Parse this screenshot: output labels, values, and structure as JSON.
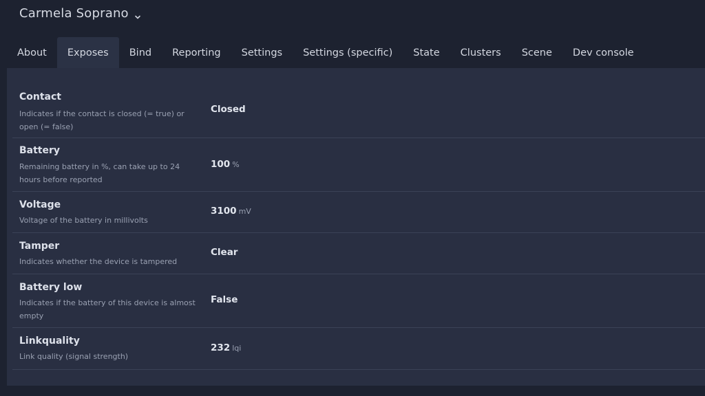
{
  "device": {
    "name": "Carmela Soprano",
    "chevron_icon": "chevron-down-icon"
  },
  "tabs": [
    {
      "label": "About"
    },
    {
      "label": "Exposes"
    },
    {
      "label": "Bind"
    },
    {
      "label": "Reporting"
    },
    {
      "label": "Settings"
    },
    {
      "label": "Settings (specific)"
    },
    {
      "label": "State"
    },
    {
      "label": "Clusters"
    },
    {
      "label": "Scene"
    },
    {
      "label": "Dev console"
    }
  ],
  "active_tab": "Exposes",
  "exposes": [
    {
      "title": "Contact",
      "description": "Indicates if the contact is closed (= true) or open (= false)",
      "value": "Closed",
      "unit": ""
    },
    {
      "title": "Battery",
      "description": "Remaining battery in %, can take up to 24 hours before reported",
      "value": "100",
      "unit": "%"
    },
    {
      "title": "Voltage",
      "description": "Voltage of the battery in millivolts",
      "value": "3100",
      "unit": "mV"
    },
    {
      "title": "Tamper",
      "description": "Indicates whether the device is tampered",
      "value": "Clear",
      "unit": ""
    },
    {
      "title": "Battery low",
      "description": "Indicates if the battery of this device is almost empty",
      "value": "False",
      "unit": ""
    },
    {
      "title": "Linkquality",
      "description": "Link quality (signal strength)",
      "value": "232",
      "unit": "lqi"
    }
  ],
  "colors": {
    "background": "#1d2230",
    "panel": "#292f42",
    "active_tab": "#2b3245",
    "divider": "#3b4257",
    "text": "#d9dde6",
    "muted_text": "#9aa1b2"
  }
}
